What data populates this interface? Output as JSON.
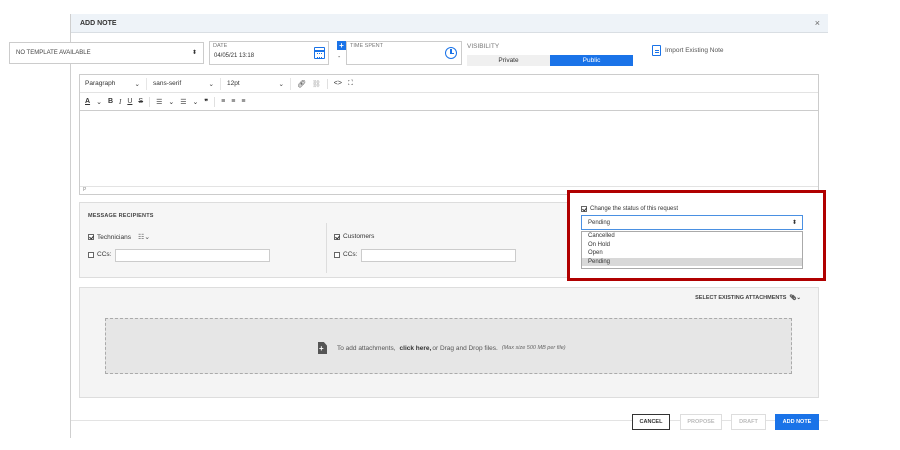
{
  "dialog": {
    "title": "ADD NOTE",
    "close_glyph": "×"
  },
  "template": {
    "value": "NO TEMPLATE AVAILABLE",
    "arrow": "⬍"
  },
  "date": {
    "label": "DATE",
    "value": "04/05/21 13:18"
  },
  "time_spent": {
    "label": "TIME SPENT",
    "plus": "+",
    "minus": "-"
  },
  "visibility": {
    "label": "VISIBILITY",
    "options": [
      "Private",
      "Public"
    ],
    "selected": "Public"
  },
  "import_note": {
    "label": "Import Existing Note"
  },
  "editor": {
    "toolbar1": {
      "paragraph": "Paragraph",
      "font": "sans-serif",
      "size": "12pt",
      "chevron": "⌄"
    },
    "toolbar2": {
      "font_color": "A",
      "bold": "B",
      "italic": "I",
      "underline": "U",
      "strike": "S",
      "bullets": "☰",
      "numbers": "☰",
      "quote": "❞",
      "align_left": "≡",
      "align_center": "≡",
      "align_right": "≡"
    },
    "status_path": "P"
  },
  "recipients": {
    "title": "MESSAGE RECIPIENTS",
    "technicians": {
      "label": "Technicians",
      "checked": true
    },
    "customers": {
      "label": "Customers",
      "checked": true
    },
    "cc_label": "CCs:"
  },
  "status": {
    "checkbox_label": "Change the status of this request",
    "checked": true,
    "selected": "Pending",
    "arrow": "⬍",
    "options": [
      "Cancelled",
      "On Hold",
      "Open",
      "Pending"
    ]
  },
  "attachments": {
    "select_existing": "SELECT EXISTING ATTACHMENTS",
    "drop_prefix": "To add attachments,",
    "drop_link": "click here,",
    "drop_suffix": "or Drag and Drop files.",
    "drop_note": "(Max size 500 MB per file)"
  },
  "footer": {
    "cancel": "CANCEL",
    "propose": "PROPOSE",
    "draft": "DRAFT",
    "add_note": "ADD NOTE"
  },
  "colors": {
    "accent": "#1a73e8",
    "highlight_border": "#b00000"
  }
}
